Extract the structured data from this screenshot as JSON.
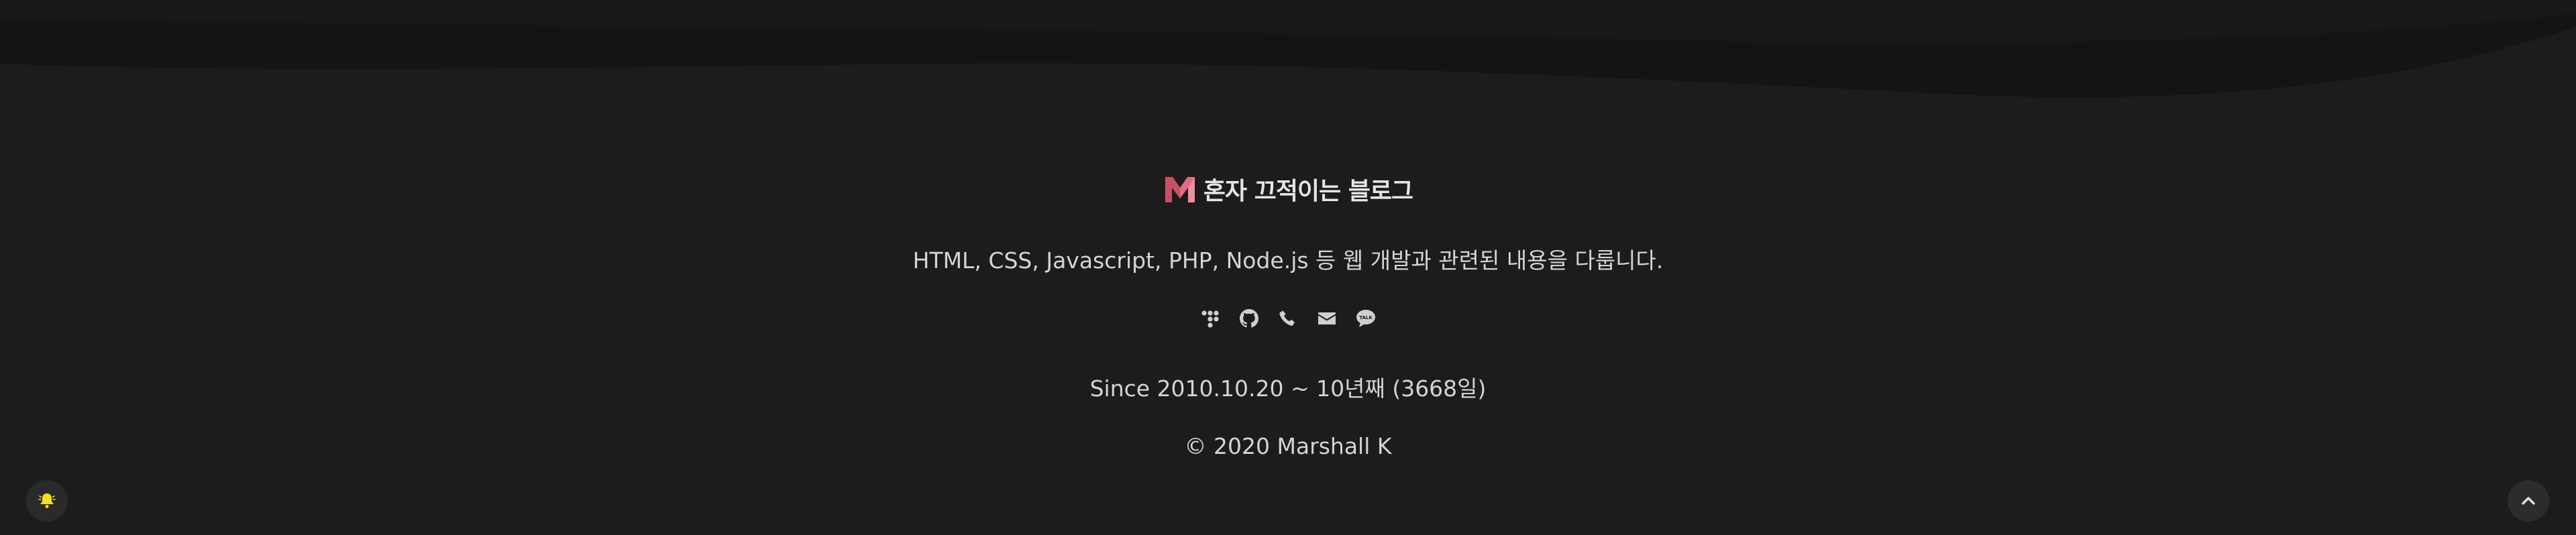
{
  "footer": {
    "logo": {
      "icon": "m-logo-icon",
      "text": "혼자 끄적이는 블로그",
      "accent": "#e36a7f"
    },
    "description": "HTML, CSS, Javascript, PHP, Node.js 등 웹 개발과 관련된 내용을 다룹니다.",
    "social_icons": [
      {
        "icon": "tistory-icon"
      },
      {
        "icon": "github-icon"
      },
      {
        "icon": "phone-icon"
      },
      {
        "icon": "mail-icon"
      },
      {
        "icon": "kakaotalk-icon"
      }
    ],
    "since": "Since 2010.10.20 ~ 10년째 (3668일)",
    "copyright": "© 2020 Marshall K"
  },
  "floating": {
    "bell": {
      "icon": "bell-icon",
      "color": "#f2e21b"
    },
    "scroll_top": {
      "icon": "chevron-up-icon"
    }
  },
  "colors": {
    "background": "#1c1c1d",
    "wave": "#131314",
    "text": "#d4d4d4"
  }
}
